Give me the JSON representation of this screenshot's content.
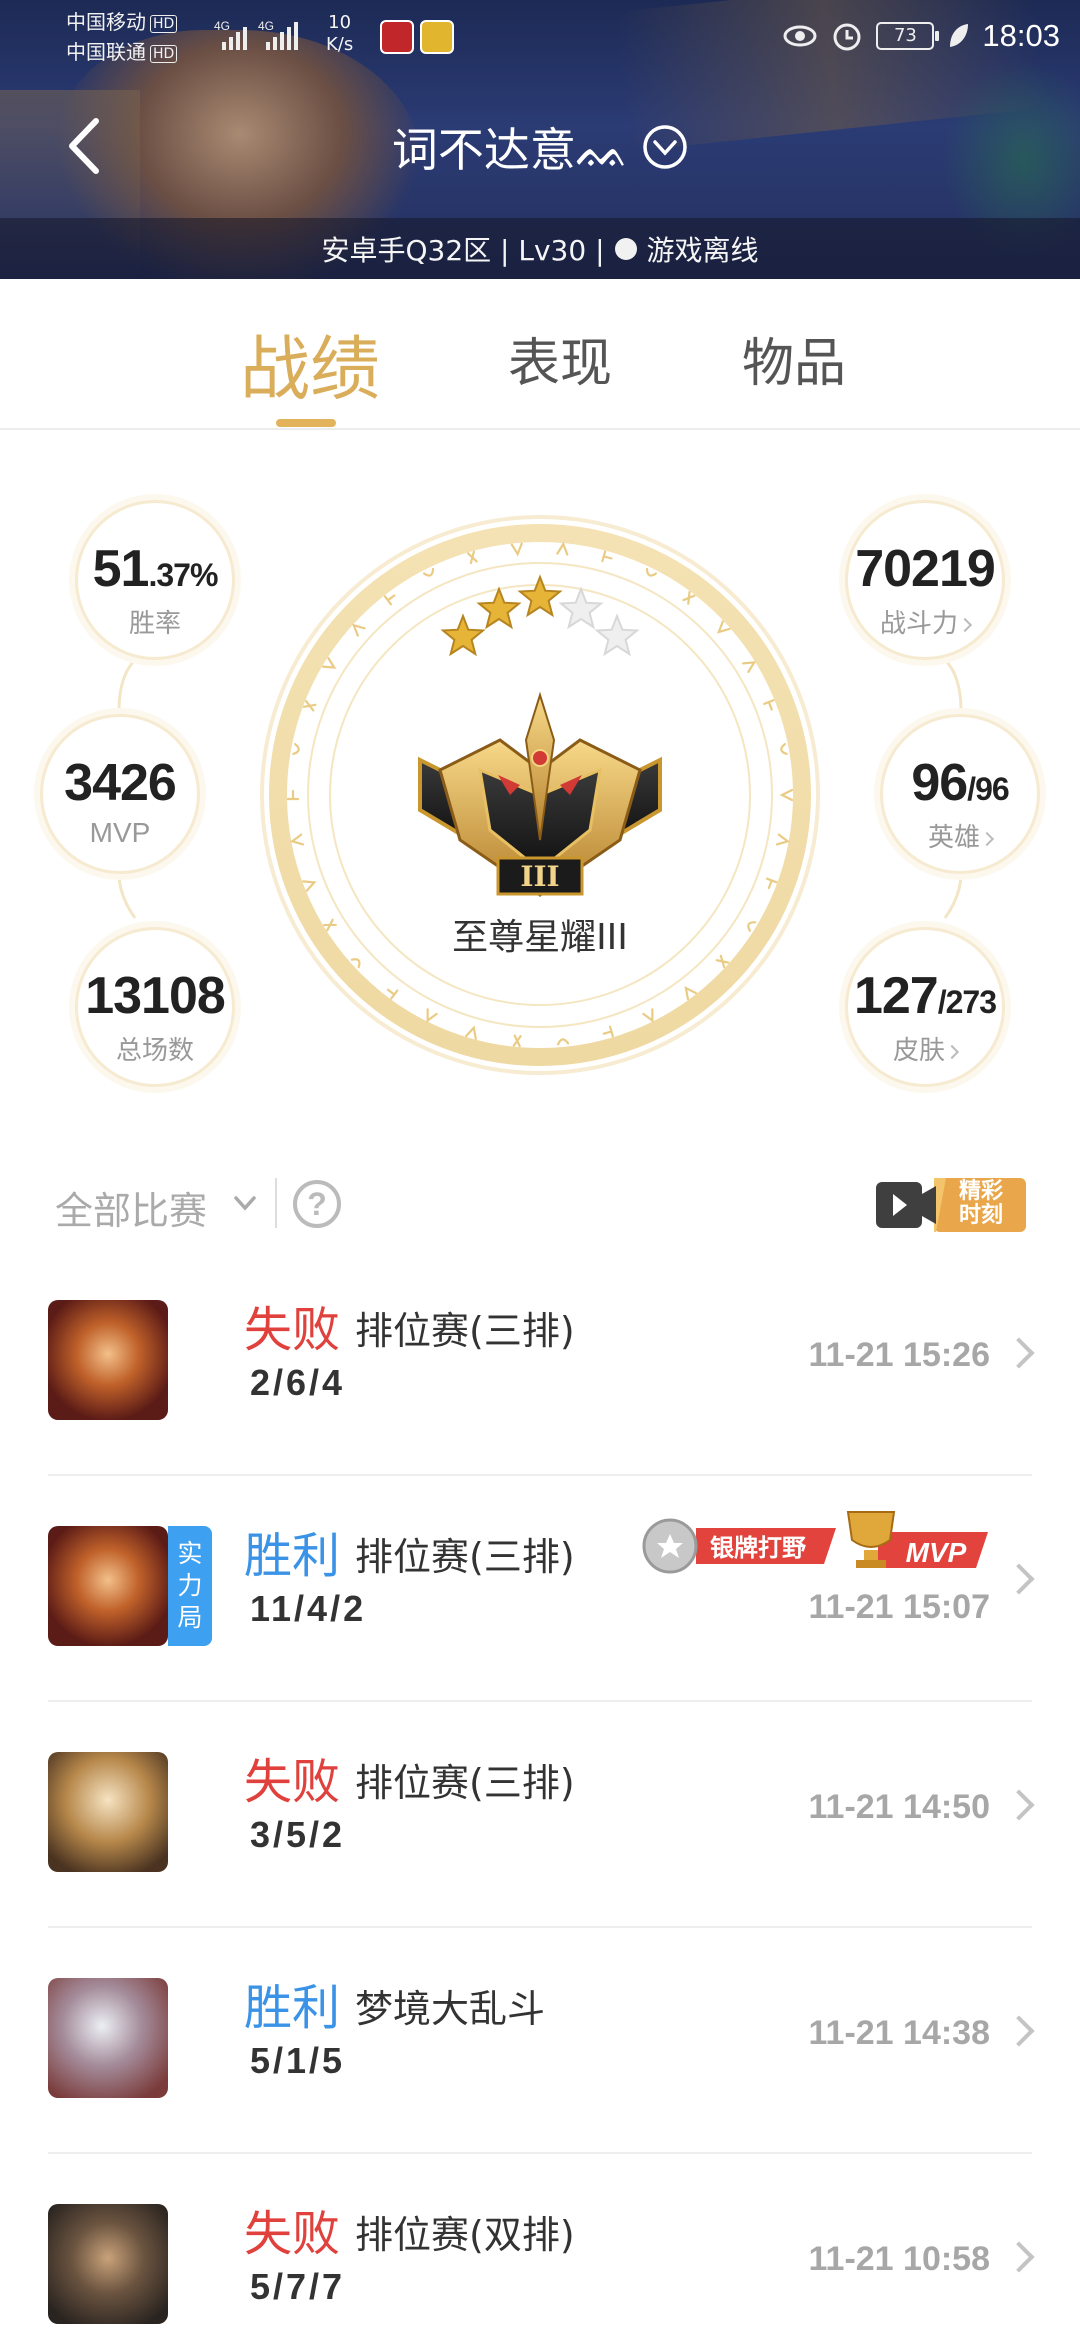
{
  "status_bar": {
    "carrier1": "中国移动",
    "carrier2": "中国联通",
    "hd": "HD",
    "net_speed_value": "10",
    "net_speed_unit": "K/s",
    "battery": "73",
    "time": "18:03"
  },
  "header": {
    "title": "词不达意ᨐ",
    "server_info": "安卓手Q32区 | Lv30 |",
    "online_status": "游戏离线"
  },
  "tabs": [
    {
      "label": "战绩",
      "active": true
    },
    {
      "label": "表现",
      "active": false
    },
    {
      "label": "物品",
      "active": false
    }
  ],
  "stats": {
    "win_rate_int": "51",
    "win_rate_dec": ".37%",
    "win_rate_label": "胜率",
    "mvp_value": "3426",
    "mvp_label": "MVP",
    "total_value": "13108",
    "total_label": "总场数",
    "power_value": "70219",
    "power_label": "战斗力",
    "heroes_value": "96",
    "heroes_total": "/96",
    "heroes_label": "英雄",
    "skins_value": "127",
    "skins_total": "/273",
    "skins_label": "皮肤"
  },
  "rank": {
    "name": "至尊星耀III",
    "stars_total": 5,
    "stars_filled": 3,
    "roman": "III"
  },
  "filter": {
    "label": "全部比赛",
    "help": "?",
    "highlight_line1": "精彩",
    "highlight_line2": "时刻"
  },
  "matches": [
    {
      "result": "失败",
      "outcome": "lose",
      "mode": "排位赛(三排)",
      "kda": "2/6/4",
      "time": "11-21 15:26",
      "strong": "",
      "avatar": "hero-fire"
    },
    {
      "result": "胜利",
      "outcome": "win",
      "mode": "排位赛(三排)",
      "kda": "11/4/2",
      "time": "11-21 15:07",
      "strong": "实力局",
      "avatar": "hero-fire",
      "tag1": "银牌打野",
      "tag2": "MVP"
    },
    {
      "result": "失败",
      "outcome": "lose",
      "mode": "排位赛(三排)",
      "kda": "3/5/2",
      "time": "11-21 14:50",
      "strong": "",
      "avatar": "hero-gold"
    },
    {
      "result": "胜利",
      "outcome": "win",
      "mode": "梦境大乱斗",
      "kda": "5/1/5",
      "time": "11-21 14:38",
      "strong": "",
      "avatar": "hero-silver"
    },
    {
      "result": "失败",
      "outcome": "lose",
      "mode": "排位赛(双排)",
      "kda": "5/7/7",
      "time": "11-21 10:58",
      "strong": "",
      "avatar": "hero-dark"
    }
  ],
  "colors": {
    "accent_gold": "#d9ad5a",
    "lose_red": "#e0413c",
    "win_blue": "#3a93e6",
    "strong_badge": "#3ea0f0"
  }
}
